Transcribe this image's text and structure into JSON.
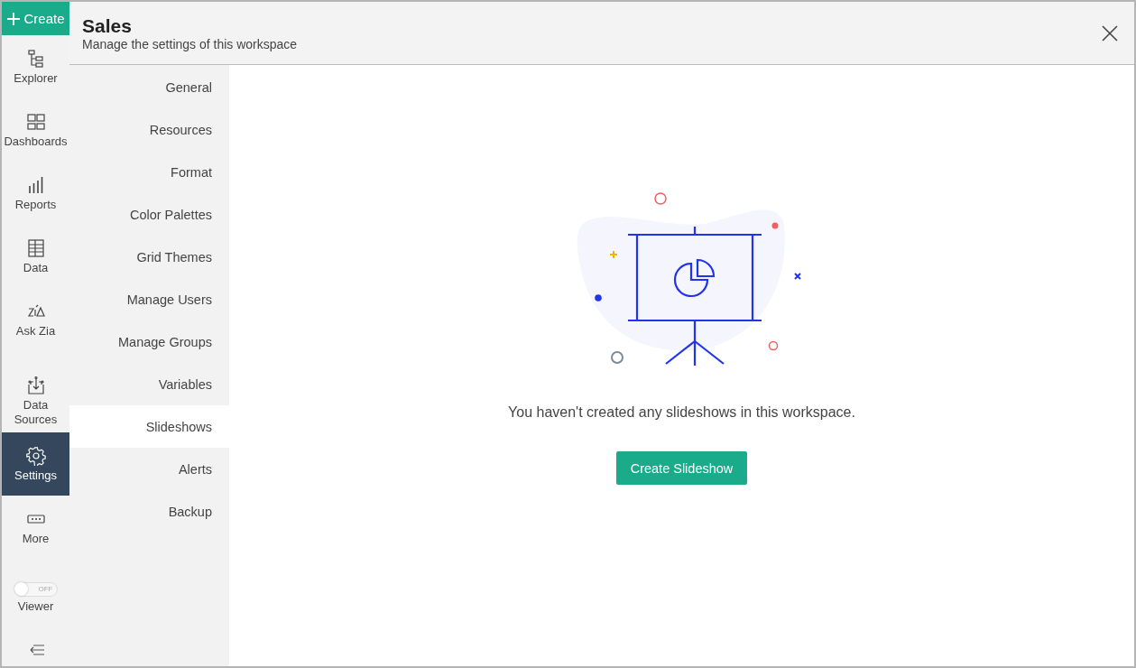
{
  "rail": {
    "create_label": "Create",
    "items": [
      {
        "kind": "explorer",
        "label": "Explorer",
        "selected": false
      },
      {
        "kind": "dashboards",
        "label": "Dashboards",
        "selected": false
      },
      {
        "kind": "reports",
        "label": "Reports",
        "selected": false
      },
      {
        "kind": "data",
        "label": "Data",
        "selected": false
      },
      {
        "kind": "zia",
        "label": "Ask Zia",
        "selected": false
      },
      {
        "kind": "sources",
        "label": "Data Sources",
        "selected": false
      },
      {
        "kind": "settings",
        "label": "Settings",
        "selected": true
      },
      {
        "kind": "more",
        "label": "More",
        "selected": false
      }
    ],
    "viewer": {
      "label": "Viewer",
      "on": false,
      "state_text": "OFF"
    }
  },
  "header": {
    "title": "Sales",
    "subtitle": "Manage the settings of this workspace"
  },
  "menu": [
    {
      "label": "General",
      "selected": false
    },
    {
      "label": "Resources",
      "selected": false
    },
    {
      "label": "Format",
      "selected": false
    },
    {
      "label": "Color Palettes",
      "selected": false
    },
    {
      "label": "Grid Themes",
      "selected": false
    },
    {
      "label": "Manage Users",
      "selected": false
    },
    {
      "label": "Manage Groups",
      "selected": false
    },
    {
      "label": "Variables",
      "selected": false
    },
    {
      "label": "Slideshows",
      "selected": true
    },
    {
      "label": "Alerts",
      "selected": false
    },
    {
      "label": "Backup",
      "selected": false
    }
  ],
  "empty_state": {
    "message": "You haven't created any slideshows in this workspace.",
    "button": "Create Slideshow"
  }
}
